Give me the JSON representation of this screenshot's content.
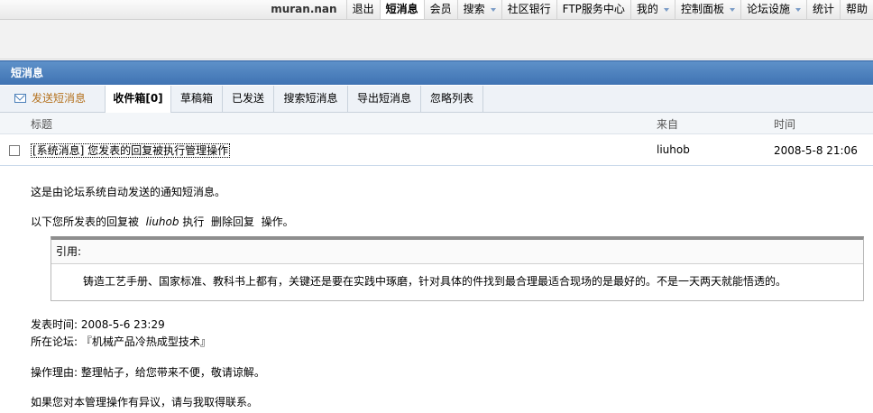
{
  "nav": {
    "user": "muran.nan",
    "items": [
      {
        "label": "退出",
        "dropdown": false
      },
      {
        "label": "短消息",
        "dropdown": false,
        "active": true
      },
      {
        "label": "会员",
        "dropdown": false
      },
      {
        "label": "搜索",
        "dropdown": true
      },
      {
        "label": "社区银行",
        "dropdown": false
      },
      {
        "label": "FTP服务中心",
        "dropdown": false
      },
      {
        "label": "我的",
        "dropdown": true
      },
      {
        "label": "控制面板",
        "dropdown": true
      },
      {
        "label": "论坛设施",
        "dropdown": true
      },
      {
        "label": "统计",
        "dropdown": false
      },
      {
        "label": "帮助",
        "dropdown": false
      }
    ]
  },
  "header": {
    "title": "短消息"
  },
  "tabs": [
    {
      "label": "发送短消息",
      "icon": "envelope-icon"
    },
    {
      "label": "收件箱[0]",
      "active": true
    },
    {
      "label": "草稿箱"
    },
    {
      "label": "已发送"
    },
    {
      "label": "搜索短消息"
    },
    {
      "label": "导出短消息"
    },
    {
      "label": "忽略列表"
    }
  ],
  "list": {
    "columns": {
      "subject": "标题",
      "from": "来自",
      "time": "时间"
    },
    "row": {
      "subject": "[系统消息] 您发表的回复被执行管理操作",
      "from": "liuhob",
      "time": "2008-5-8 21:06"
    }
  },
  "message": {
    "line1": "这是由论坛系统自动发送的通知短消息。",
    "line2_prefix": "以下您所发表的回复被",
    "line2_user": "liuhob",
    "line2_suffix": "执行  删除回复  操作。",
    "quote_title": "引用:",
    "quote_text": "铸造工艺手册、国家标准、教科书上都有，关键还是要在实践中琢磨，针对具体的件找到最合理最适合现场的是最好的。不是一天两天就能悟透的。",
    "post_time": "发表时间: 2008-5-6 23:29",
    "forum": "所在论坛: 『机械产品冷热成型技术』",
    "reason": "操作理由: 整理帖子，给您带来不便，敬请谅解。",
    "contact": "如果您对本管理操作有异议，请与我取得联系。"
  },
  "colors": {
    "header_bg": "#4a7fbf",
    "tab_send": "#b4721e"
  }
}
